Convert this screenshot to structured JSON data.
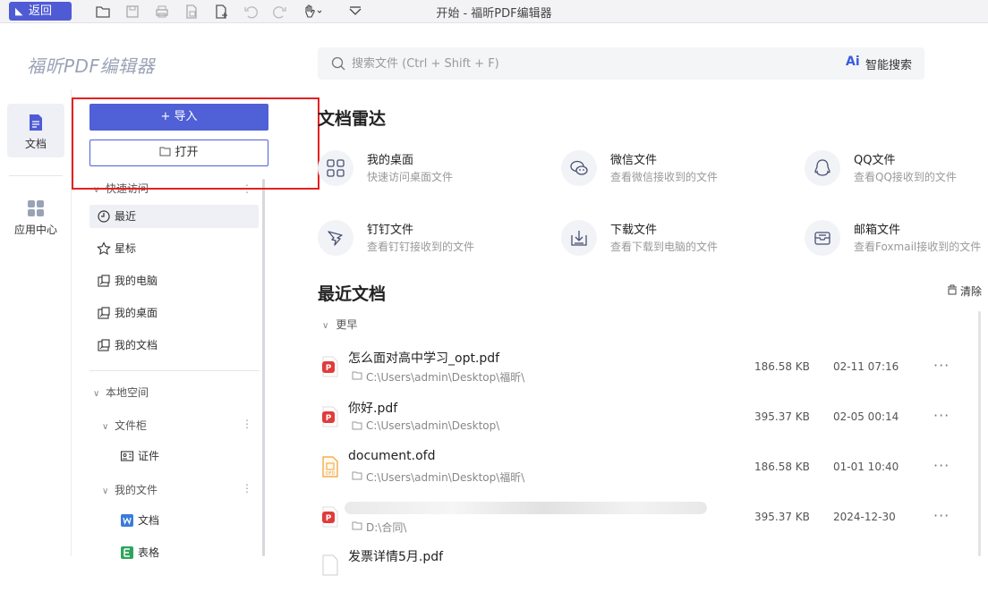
{
  "toolbar": {
    "back_label": "返回",
    "window_title": "开始 - 福昕PDF编辑器"
  },
  "brand": {
    "name": "福昕PDF编辑器"
  },
  "search": {
    "placeholder": "搜索文件 (Ctrl + Shift + F)",
    "ai_label": "智能搜索"
  },
  "rail": {
    "items": [
      {
        "label": "文档",
        "icon": "document-icon"
      },
      {
        "label": "应用中心",
        "icon": "apps-grid-icon"
      }
    ]
  },
  "panel": {
    "import_label": "+ 导入",
    "open_label": "打开",
    "quick_access": {
      "title": "快速访问",
      "items": [
        "最近",
        "星标",
        "我的电脑",
        "我的桌面",
        "我的文档"
      ]
    },
    "local_space": {
      "title": "本地空间",
      "cabinet": "文件柜",
      "cabinet_items": [
        "证件"
      ],
      "my_files": "我的文件",
      "my_files_items": [
        "文档",
        "表格"
      ]
    }
  },
  "radar": {
    "title": "文档雷达",
    "cards": [
      {
        "title": "我的桌面",
        "subtitle": "快速访问桌面文件",
        "icon": "desktop-grid-icon"
      },
      {
        "title": "微信文件",
        "subtitle": "查看微信接收到的文件",
        "icon": "wechat-icon"
      },
      {
        "title": "QQ文件",
        "subtitle": "查看QQ接收到的文件",
        "icon": "qq-icon"
      },
      {
        "title": "钉钉文件",
        "subtitle": "查看钉钉接收到的文件",
        "icon": "dingtalk-icon"
      },
      {
        "title": "下载文件",
        "subtitle": "查看下载到电脑的文件",
        "icon": "download-icon"
      },
      {
        "title": "邮箱文件",
        "subtitle": "查看Foxmail接收到的文件",
        "icon": "mail-icon"
      }
    ]
  },
  "recent": {
    "title": "最近文档",
    "clear_label": "清除",
    "group_label": "更早",
    "rows": [
      {
        "name": "怎么面对高中学习_opt.pdf",
        "path": "C:\\Users\\admin\\Desktop\\福昕\\",
        "size": "186.58 KB",
        "date": "02-11 07:16",
        "type": "pdf"
      },
      {
        "name": "你好.pdf",
        "path": "C:\\Users\\admin\\Desktop\\",
        "size": "395.37 KB",
        "date": "02-05 00:14",
        "type": "pdf"
      },
      {
        "name": "document.ofd",
        "path": "C:\\Users\\admin\\Desktop\\福昕\\",
        "size": "186.58 KB",
        "date": "01-01 10:40",
        "type": "ofd"
      },
      {
        "name": "",
        "path": "D:\\合同\\",
        "size": "395.37 KB",
        "date": "2024-12-30",
        "type": "pdf"
      },
      {
        "name": "发票详情5月.pdf",
        "path": "",
        "size": "",
        "date": "",
        "type": "pdf"
      }
    ]
  },
  "colors": {
    "accent": "#5060d6",
    "highlight_box": "#e32121",
    "pdf_red": "#e23b3b",
    "ofd_orange": "#f0a030"
  }
}
